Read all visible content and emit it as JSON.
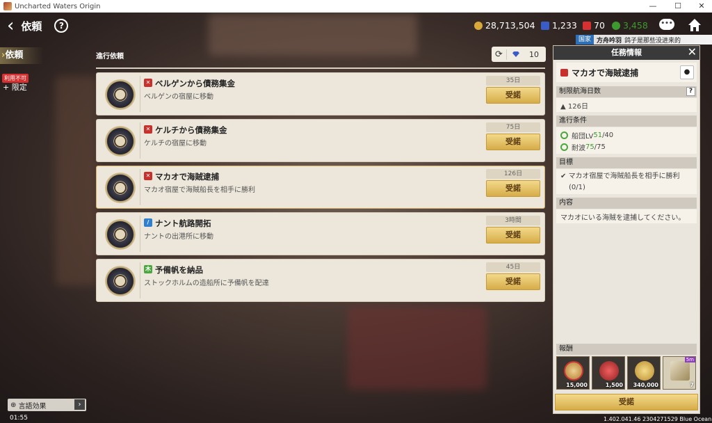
{
  "window": {
    "title": "Uncharted Waters Origin",
    "minimize": "—",
    "maximize": "☐",
    "close": "✕"
  },
  "header": {
    "back": "‹",
    "title": "依頼",
    "help": "?"
  },
  "currency": {
    "ducats": "28,713,504",
    "gems": "1,233",
    "rubies": "70",
    "other": "3,458",
    "ducat_color": "#d9a83a",
    "gem_color": "#3a5cc7",
    "ruby_color": "#d63030",
    "other_color": "#3c9a2f"
  },
  "chat_icon": "•••",
  "news": {
    "tag": "国家",
    "name": "方舟吟羽",
    "text": "鸽子是那些没进来的"
  },
  "sidebar": {
    "tab": "依頼",
    "badge": "利用不可",
    "limited": "+ 限定"
  },
  "list": {
    "heading": "進行依頼",
    "refresh_count": "10"
  },
  "quests": [
    {
      "type": "battle",
      "icon_color": "#c9302c",
      "icon": "✕",
      "title": "ベルゲンから債務集金",
      "desc": "ベルゲンの宿屋に移動",
      "days": "35日",
      "accept": "受諾"
    },
    {
      "type": "battle",
      "icon_color": "#c9302c",
      "icon": "✕",
      "title": "ケルチから債務集金",
      "desc": "ケルチの宿屋に移動",
      "days": "75日",
      "accept": "受諾"
    },
    {
      "type": "battle",
      "icon_color": "#c9302c",
      "icon": "✕",
      "title": "マカオで海賊逮捕",
      "desc": "マカオ宿屋で海賊船長を相手に勝利",
      "days": "126日",
      "accept": "受諾"
    },
    {
      "type": "explore",
      "icon_color": "#2f7fd0",
      "icon": "/",
      "title": "ナント航路開拓",
      "desc": "ナントの出港所に移動",
      "days": "3時間",
      "accept": "受諾"
    },
    {
      "type": "trade",
      "icon_color": "#4aa73e",
      "icon": "木",
      "title": "予備帆を納品",
      "desc": "ストックホルムの造船所に予備帆を配達",
      "days": "45日",
      "accept": "受諾"
    }
  ],
  "panel": {
    "title": "任務情報",
    "close": "✕",
    "quest_title": "マカオで海賊逮捕",
    "sec_limit": "制限航海日数",
    "limit_value": "126日",
    "sec_conditions": "進行条件",
    "conditions": [
      {
        "label": "船団LV",
        "current": "51",
        "total": "/40"
      },
      {
        "label": "耐波",
        "current": "75",
        "total": "/75"
      }
    ],
    "sec_goal": "目標",
    "goal_text": "マカオ宿屋で海賊船長を相手に勝利",
    "goal_progress": "(0/1)",
    "sec_content": "内容",
    "content_text": "マカオにいる海賊を逮捕してください。",
    "sec_rewards": "報酬",
    "rewards": [
      {
        "name": "medal",
        "count": "15,000"
      },
      {
        "name": "fame",
        "count": "1,500"
      },
      {
        "name": "coin",
        "count": "340,000"
      },
      {
        "name": "scroll",
        "count": "7",
        "tag": "5m"
      }
    ],
    "accept": "受諾"
  },
  "bottom": {
    "lang": "言語効果",
    "clock": "01:55",
    "version": "1.402.041.46 2304271529 Blue Ocean"
  }
}
